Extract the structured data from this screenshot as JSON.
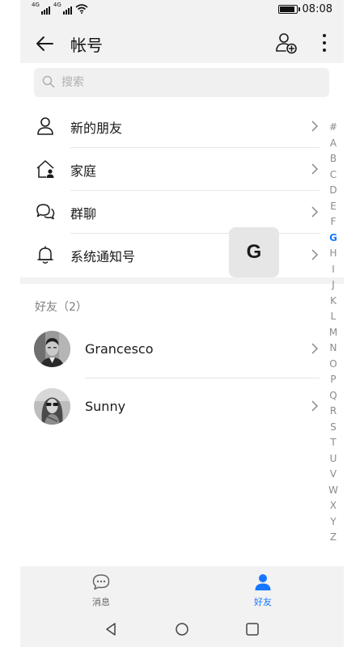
{
  "status": {
    "signal1": "4G",
    "signal2": "4G",
    "time": "08:08"
  },
  "header": {
    "title": "帐号",
    "back_icon": "arrow-left-icon",
    "add_icon": "add-user-icon",
    "more_icon": "more-vert-icon"
  },
  "search": {
    "placeholder": "搜索"
  },
  "menu": {
    "items": [
      {
        "label": "新的朋友",
        "icon": "person-icon"
      },
      {
        "label": "家庭",
        "icon": "home-person-icon"
      },
      {
        "label": "群聊",
        "icon": "chat-bubbles-icon"
      },
      {
        "label": "系统通知号",
        "icon": "bell-icon"
      }
    ]
  },
  "friends": {
    "title": "好友（2）",
    "list": [
      {
        "name": "Grancesco"
      },
      {
        "name": "Sunny"
      }
    ]
  },
  "index": {
    "letters": [
      "#",
      "A",
      "B",
      "C",
      "D",
      "E",
      "F",
      "G",
      "H",
      "I",
      "J",
      "K",
      "L",
      "M",
      "N",
      "O",
      "P",
      "Q",
      "R",
      "S",
      "T",
      "U",
      "V",
      "W",
      "X",
      "Y",
      "Z"
    ],
    "active": "G"
  },
  "bubble": {
    "letter": "G"
  },
  "tabs": [
    {
      "label": "消息",
      "icon": "chat-icon",
      "active": false
    },
    {
      "label": "好友",
      "icon": "contacts-icon",
      "active": true
    }
  ],
  "colors": {
    "accent": "#1677ff",
    "inactive": "#666666",
    "divider": "#e6e6e6",
    "background": "#f2f2f2"
  }
}
